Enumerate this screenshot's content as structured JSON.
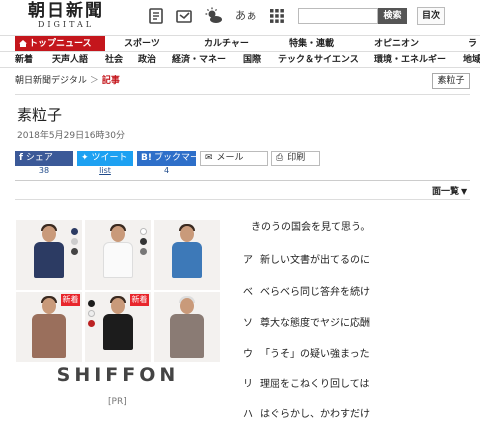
{
  "header": {
    "logo_main": "朝日新聞",
    "logo_sub": "DIGITAL",
    "search_placeholder": "",
    "search_button": "検索",
    "toc_button": "目次",
    "font_size_glyph": "あぁ"
  },
  "nav_primary": [
    "トップニュース",
    "スポーツ",
    "カルチャー",
    "特集・連載",
    "オピニオン",
    "ラ"
  ],
  "nav_secondary": [
    "新着",
    "天声人語",
    "社会",
    "政治",
    "経済・マネー",
    "国際",
    "テック＆サイエンス",
    "環境・エネルギー",
    "地域"
  ],
  "breadcrumb": {
    "home": "朝日新聞デジタル",
    "separator": "＞",
    "current": "記事"
  },
  "tag": "素粒子",
  "article": {
    "title": "素粒子",
    "date": "2018年5月29日16時30分"
  },
  "share": {
    "facebook_label": "シェア",
    "facebook_count": "38",
    "twitter_label": "ツイート",
    "twitter_count": "list",
    "hatena_label": "ブックマー",
    "hatena_count": "4",
    "mail_label": "メール",
    "print_label": "印刷"
  },
  "list_link": "面一覧",
  "ad": {
    "brand": "SHIFFON",
    "new_badge": "新着",
    "pr_label": "[PR]"
  },
  "poem": [
    {
      "head": "",
      "text": "きのうの国会を見て思う。"
    },
    {
      "head": "ア",
      "text": "新しい文書が出てるのに"
    },
    {
      "head": "べ",
      "text": "べらべら同じ答弁を続け"
    },
    {
      "head": "ソ",
      "text": "尊大な態度でヤジに応酬"
    },
    {
      "head": "ウ",
      "text": "「うそ」の疑い強まった"
    },
    {
      "head": "リ",
      "text": "理屈をこねくり回しては"
    },
    {
      "head": "ハ",
      "text": "はぐらかし、かわすだけ"
    }
  ],
  "colors": {
    "accent_red": "#c4161c",
    "facebook": "#3b5998",
    "twitter": "#1da1f2",
    "hatena": "#2e6fc9"
  }
}
